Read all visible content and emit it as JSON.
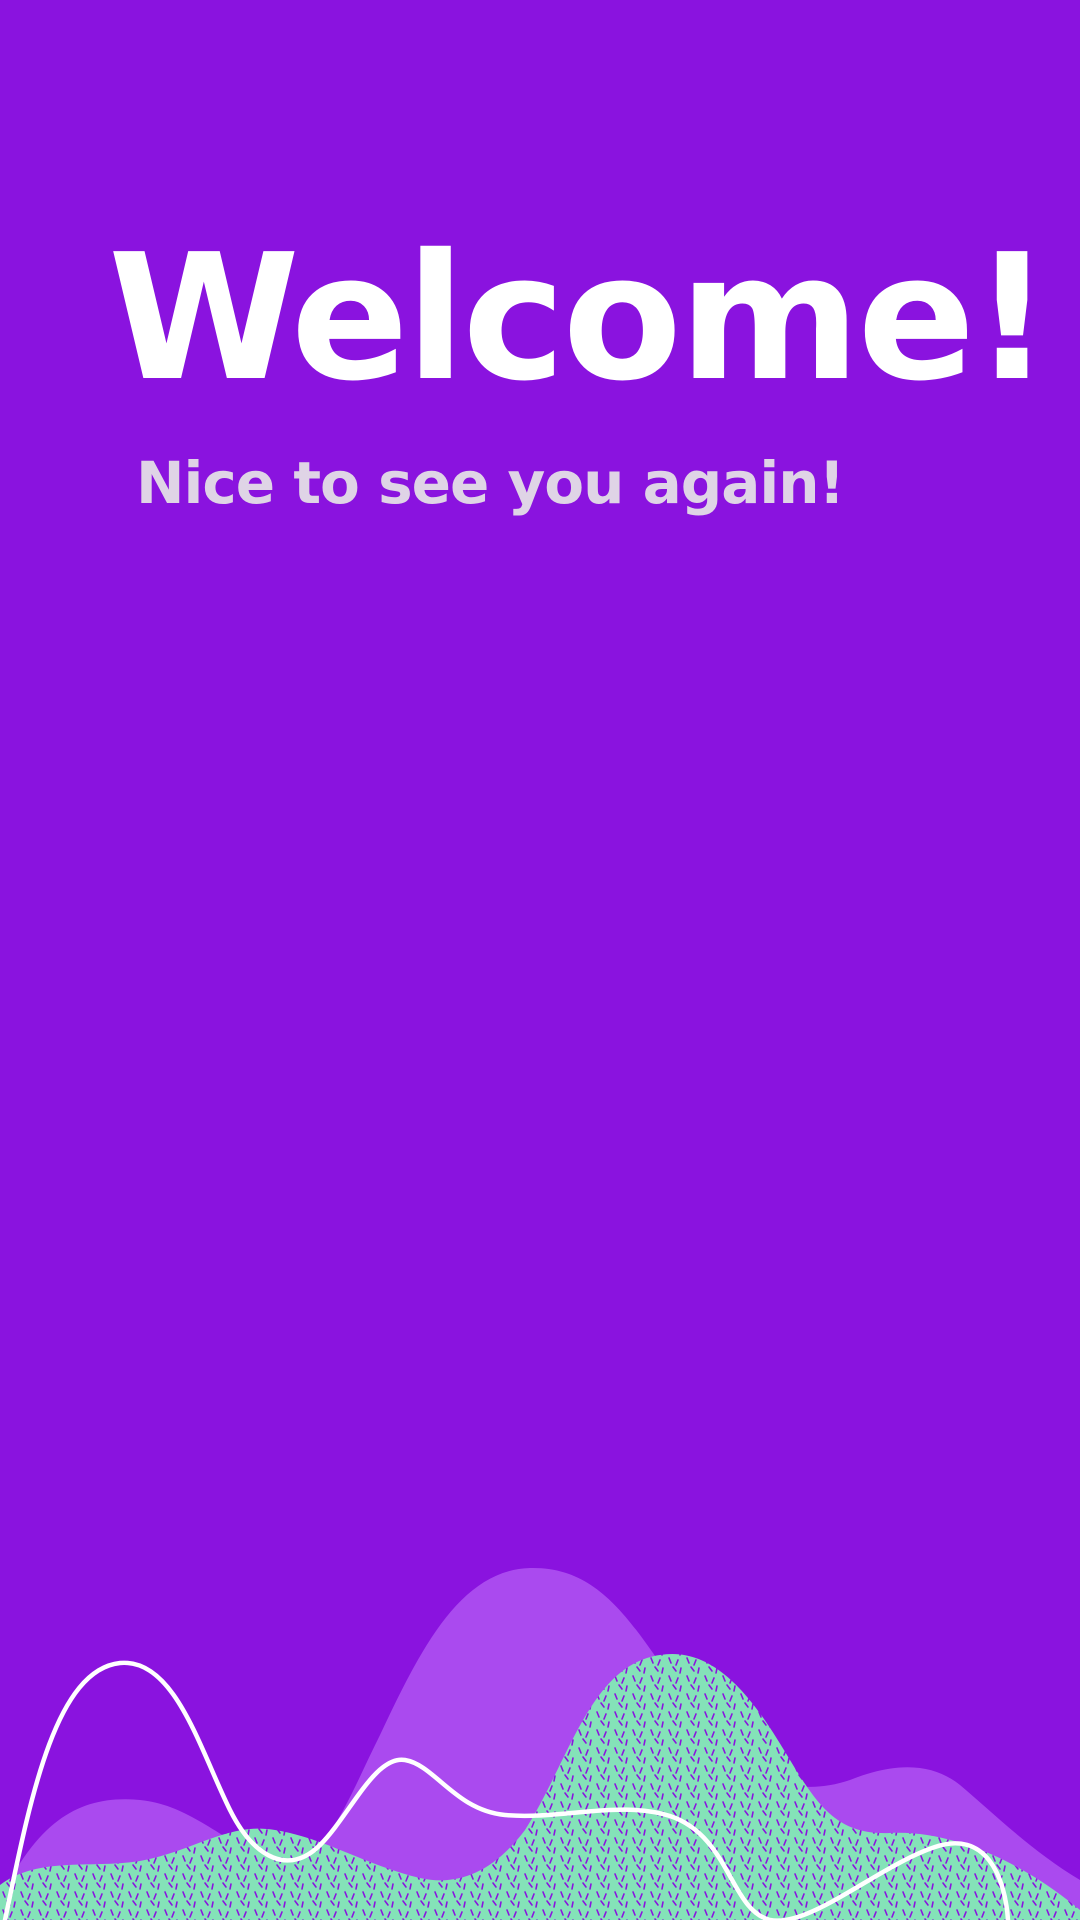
{
  "welcome": {
    "title": "Welcome!",
    "subtitle": "Nice to see you again!"
  },
  "colors": {
    "background": "#8a13df",
    "title": "#ffffff",
    "subtitle": "#dfd4e6",
    "wave_back": "#aa4aef",
    "wave_front": "#84e2b8",
    "wave_front_pattern": "#8a13df",
    "wave_line": "#ffffff"
  },
  "decor": {
    "name": "wave-illustration"
  }
}
